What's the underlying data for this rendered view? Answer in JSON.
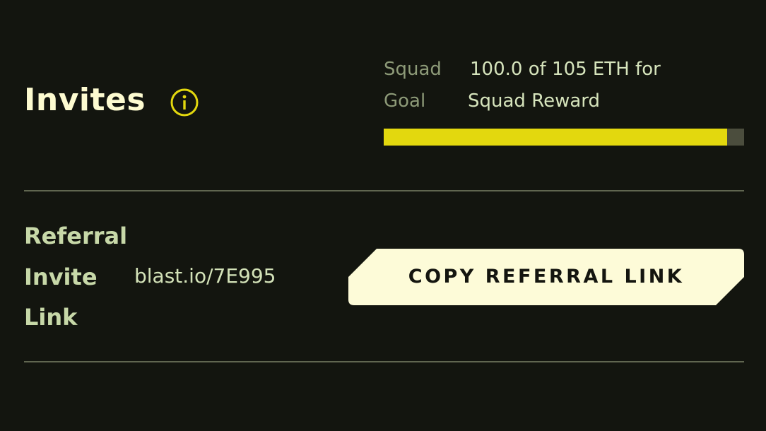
{
  "header": {
    "title": "Invites",
    "info_icon": "info-circle-icon"
  },
  "squad_goal": {
    "label_line1": "Squad",
    "label_line2": "Goal",
    "value_line1": "100.0 of 105 ETH for",
    "value_line2": "Squad Reward",
    "progress_percent": 95.2
  },
  "referral": {
    "label_line1": "Referral",
    "label_line2": "Invite",
    "label_line3": "Link",
    "link": "blast.io/7E995",
    "copy_button_label": "COPY REFERRAL LINK"
  },
  "colors": {
    "background": "#13150f",
    "title": "#fdfbd0",
    "accent_yellow": "#e3d80e",
    "progress_track": "#4b4d3d",
    "button_bg": "#fdfbd8",
    "muted_label": "#8d9a78",
    "divider": "#606650"
  }
}
